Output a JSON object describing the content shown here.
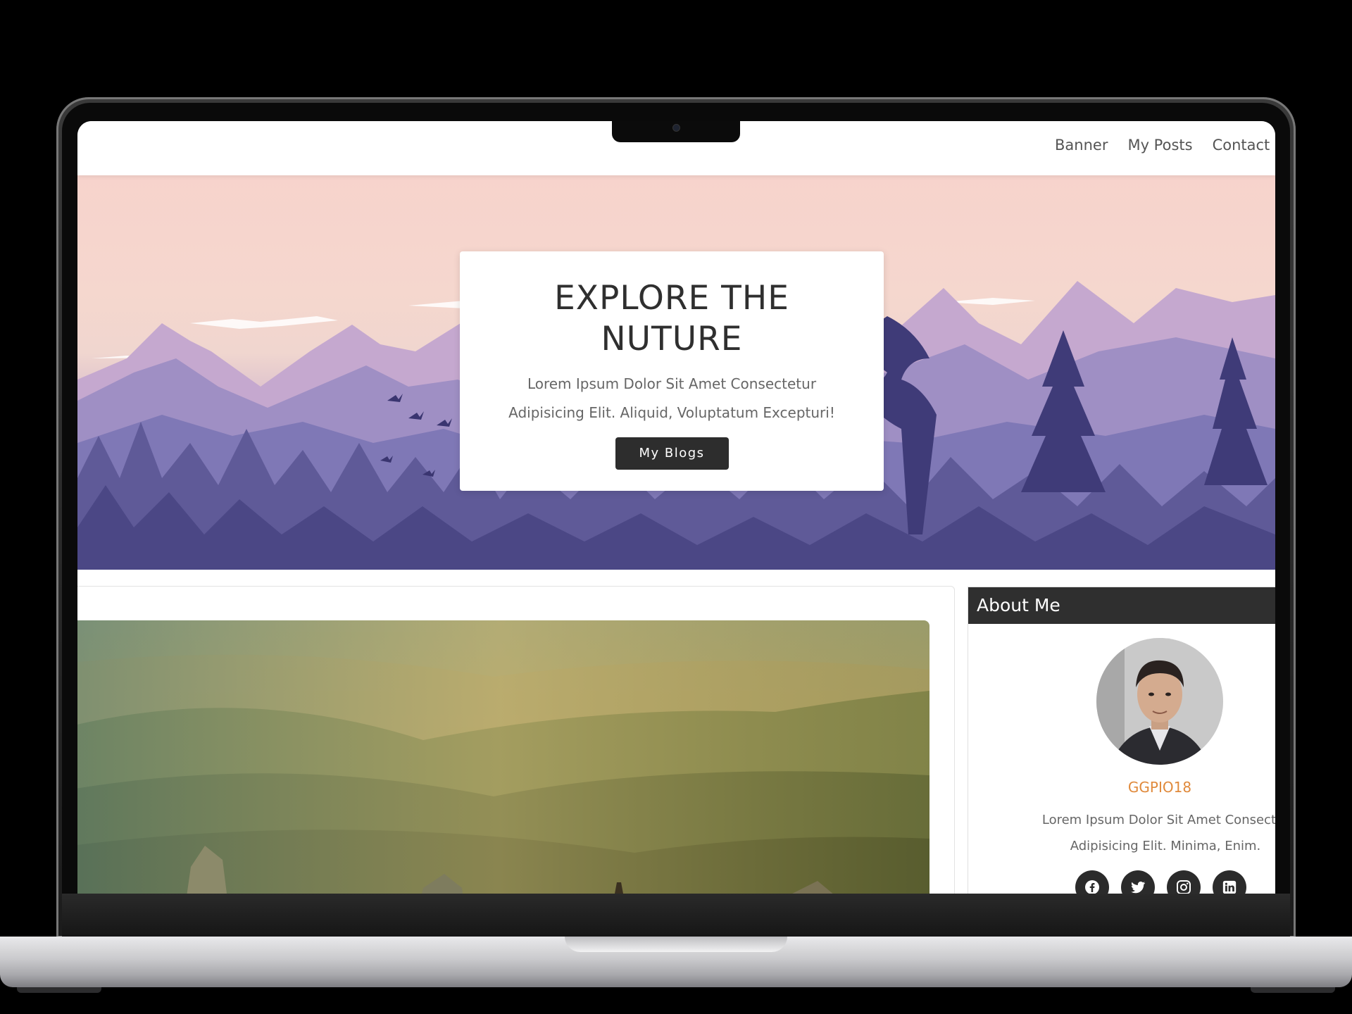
{
  "nav": {
    "links": [
      "Banner",
      "My Posts",
      "Contact M"
    ]
  },
  "hero": {
    "title_line1": "EXPLORE THE",
    "title_line2": "NUTURE",
    "subtitle_line1": "Lorem Ipsum Dolor Sit Amet Consectetur",
    "subtitle_line2": "Adipisicing Elit. Aliquid, Voluptatum Excepturi!",
    "button_label": "My Blogs"
  },
  "sidebar": {
    "heading": "About Me",
    "username": "GGPIO18",
    "bio_line1": "Lorem Ipsum Dolor Sit Amet Consectet",
    "bio_line2": "Adipisicing Elit. Minima, Enim.",
    "socials": [
      "facebook-icon",
      "twitter-icon",
      "instagram-icon",
      "linkedin-icon"
    ]
  },
  "colors": {
    "accent": "#e08a3c",
    "dark": "#2d2d2d",
    "hero_sky": "#f7d3cc",
    "hero_mountain": "#7c74b0"
  }
}
